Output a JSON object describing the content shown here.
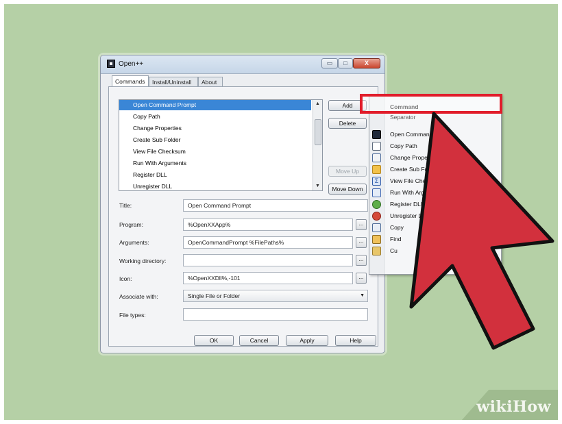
{
  "window": {
    "title": "Open++",
    "controls": {
      "minimize": "▭",
      "maximize": "□",
      "close": "X"
    }
  },
  "tabs": [
    "Commands",
    "Install/Uninstall",
    "About"
  ],
  "commands_list": {
    "items": [
      "Open Command Prompt",
      "Copy Path",
      "Change Properties",
      "Create Sub Folder",
      "View File Checksum",
      "Run With Arguments",
      "Register DLL",
      "Unregister DLL"
    ],
    "selected_index": 0
  },
  "side_buttons": {
    "add": "Add",
    "delete": "Delete",
    "move_up": "Move Up",
    "move_down": "Move Down"
  },
  "form": {
    "title_label": "Title:",
    "title_value": "Open Command Prompt",
    "program_label": "Program:",
    "program_value": "%OpenXXApp%",
    "arguments_label": "Arguments:",
    "arguments_value": "OpenCommandPrompt %FilePaths%",
    "workdir_label": "Working directory:",
    "workdir_value": "",
    "icon_label": "Icon:",
    "icon_value": "%OpenXXDll%,-101",
    "associate_label": "Associate with:",
    "associate_value": "Single File or Folder",
    "filetypes_label": "File types:",
    "filetypes_value": "",
    "browse_label": "..."
  },
  "footer": {
    "ok": "OK",
    "cancel": "Cancel",
    "apply": "Apply",
    "help": "Help"
  },
  "add_menu": {
    "items": [
      {
        "label": "Command",
        "icon": "none"
      },
      {
        "label": "Separator",
        "icon": "none"
      },
      {
        "label": "Open Command Prompt",
        "icon": "cmd-icon"
      },
      {
        "label": "Copy Path",
        "icon": "document-icon"
      },
      {
        "label": "Change Properties",
        "icon": "properties-icon"
      },
      {
        "label": "Create Sub Folder",
        "icon": "folder-icon"
      },
      {
        "label": "View File Checksum",
        "icon": "sigma-icon"
      },
      {
        "label": "Run With Arguments",
        "icon": "run-icon"
      },
      {
        "label": "Register DLL",
        "icon": "register-icon"
      },
      {
        "label": "Unregister DLL",
        "icon": "unregister-icon"
      },
      {
        "label": "Copy",
        "icon": "copy-icon"
      },
      {
        "label": "Find",
        "icon": "find-icon"
      },
      {
        "label": "Cu",
        "icon": "customize-icon"
      }
    ],
    "highlighted_item": "Command"
  },
  "watermark": "wikiHow",
  "colors": {
    "background": "#b5d0a6",
    "arrow_fill": "#d2303d",
    "highlight_border": "#e11d2b",
    "selection": "#3a86d6"
  }
}
